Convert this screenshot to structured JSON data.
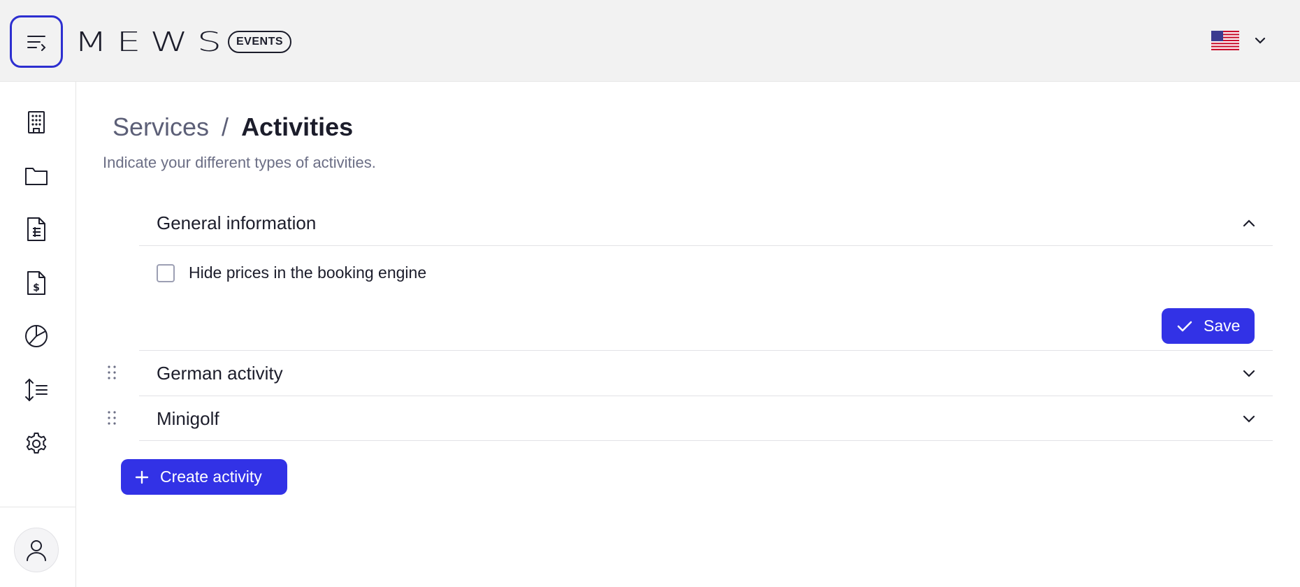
{
  "header": {
    "logo_text": "MEWS",
    "logo_badge": "EVENTS",
    "menu_icon": "menu-collapse-icon",
    "language_flag": "us-flag-icon"
  },
  "sidebar": {
    "items": [
      {
        "icon": "building-icon"
      },
      {
        "icon": "folder-icon"
      },
      {
        "icon": "document-list-icon"
      },
      {
        "icon": "invoice-dollar-icon"
      },
      {
        "icon": "pie-chart-icon"
      },
      {
        "icon": "sort-list-icon"
      },
      {
        "icon": "gear-icon"
      }
    ],
    "user_icon": "user-icon"
  },
  "breadcrumb": {
    "parent": "Services",
    "separator": "/",
    "current": "Activities"
  },
  "subtitle": "Indicate your different types of activities.",
  "general_section": {
    "title": "General information",
    "checkbox_label": "Hide prices in the booking engine",
    "checkbox_checked": false,
    "save_label": "Save"
  },
  "activities": [
    {
      "title": "German activity"
    },
    {
      "title": "Minigolf"
    }
  ],
  "create_label": "Create activity",
  "colors": {
    "accent": "#3232e6",
    "focus_ring": "#2d2fd0",
    "header_bg": "#f2f2f2",
    "muted_text": "#5c5f77"
  }
}
